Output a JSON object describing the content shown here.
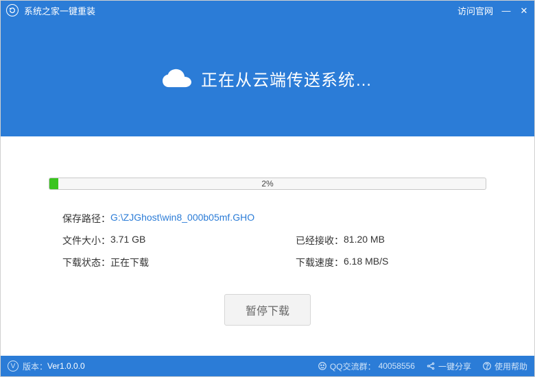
{
  "titlebar": {
    "app_name": "系统之家一键重装",
    "official_link": "访问官网"
  },
  "hero": {
    "title": "正在从云端传送系统…"
  },
  "progress": {
    "percent_text": "2%",
    "percent_value": 2
  },
  "info": {
    "save_path_label": "保存路径：",
    "save_path_value": "G:\\ZJGhost\\win8_000b05mf.GHO",
    "file_size_label": "文件大小：",
    "file_size_value": "3.71 GB",
    "received_label": "已经接收：",
    "received_value": "81.20 MB",
    "status_label": "下载状态：",
    "status_value": "正在下载",
    "speed_label": "下载速度：",
    "speed_value": "6.18 MB/S"
  },
  "buttons": {
    "pause": "暂停下载"
  },
  "statusbar": {
    "version_label": "版本：",
    "version_value": "Ver1.0.0.0",
    "qq_label": "QQ交流群：",
    "qq_value": "40058556",
    "share_label": "一键分享",
    "help_label": "使用帮助"
  }
}
